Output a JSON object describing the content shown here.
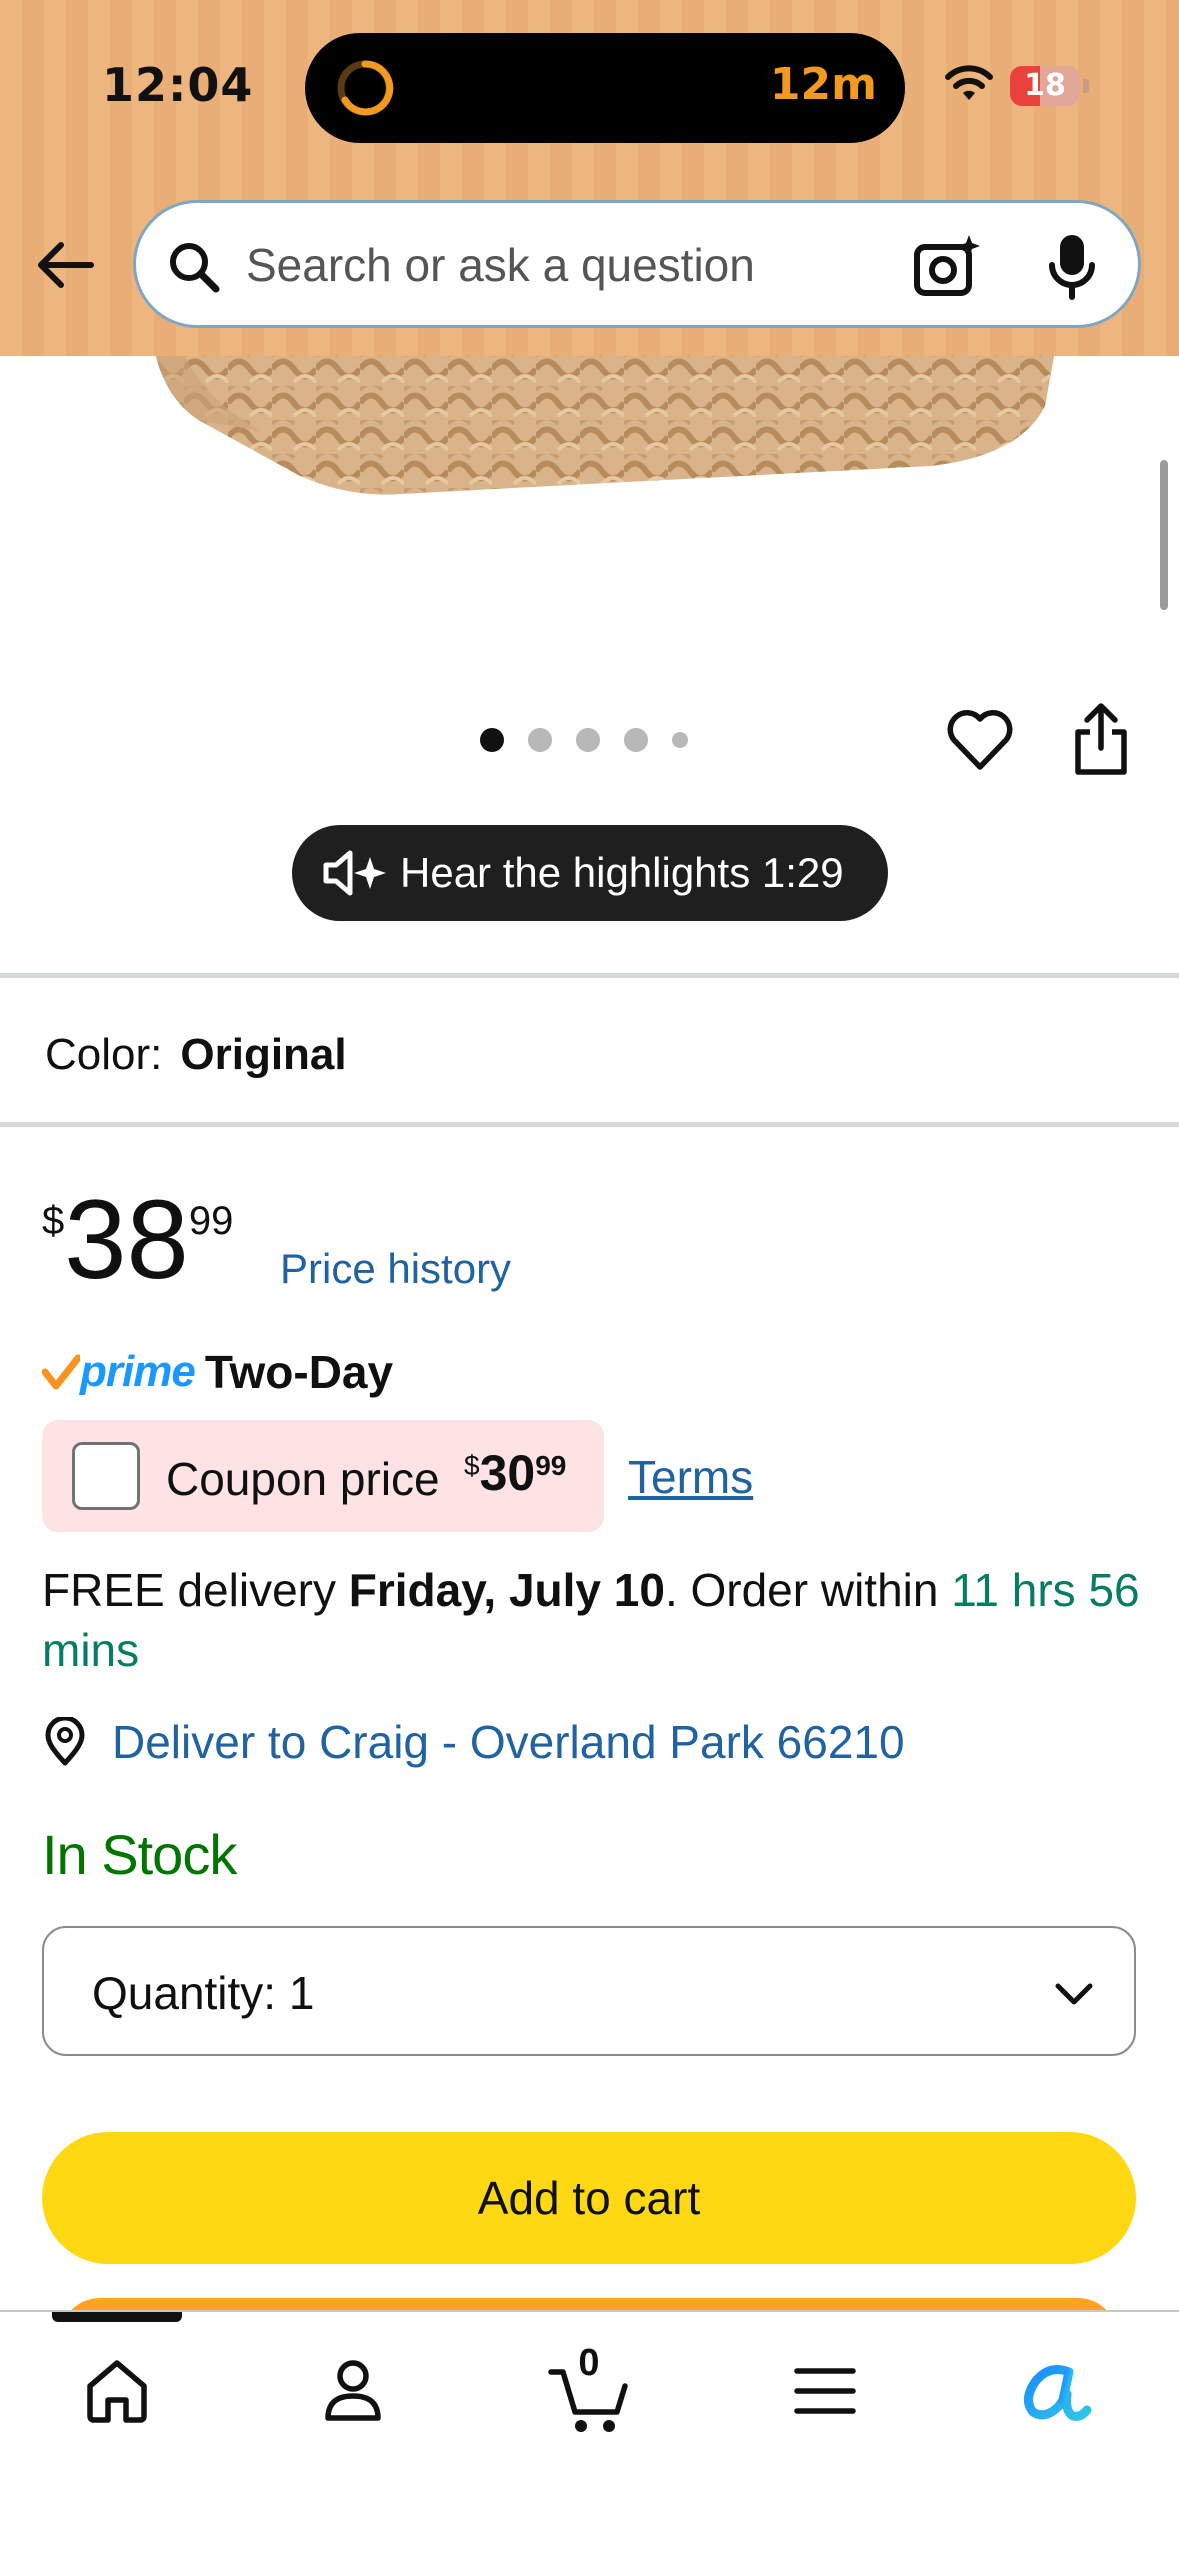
{
  "status_bar": {
    "time": "12:04",
    "activity_text": "12m",
    "battery": "18"
  },
  "search": {
    "placeholder": "Search or ask a question"
  },
  "gallery": {
    "dot_count": 5,
    "active_index": 0
  },
  "audio": {
    "label": "Hear the highlights 1:29"
  },
  "color": {
    "label": "Color:",
    "value": "Original"
  },
  "price": {
    "symbol": "$",
    "whole": "38",
    "fraction": "99",
    "history_link": "Price history"
  },
  "prime": {
    "word": "prime",
    "shipping": "Two-Day"
  },
  "coupon": {
    "label": "Coupon price",
    "symbol": "$",
    "whole": "30",
    "fraction": "99",
    "terms_link": "Terms"
  },
  "delivery": {
    "prefix": "FREE delivery ",
    "date": "Friday, July 10",
    "middle": ". Order within ",
    "countdown": "11 hrs 56 mins"
  },
  "deliver_to": {
    "text": "Deliver to Craig - Overland Park 66210"
  },
  "stock": {
    "status": "In Stock"
  },
  "quantity": {
    "label": "Quantity:",
    "value": "1"
  },
  "actions": {
    "add_to_cart": "Add to cart"
  },
  "bottom_nav": {
    "cart_count": "0",
    "items": [
      "home-icon",
      "account-icon",
      "cart-icon",
      "menu-icon",
      "rufus-icon"
    ]
  },
  "colors": {
    "header_bg": "#eeb67f",
    "add_to_cart": "#ffd814",
    "link": "#2162a1",
    "in_stock": "#007600",
    "coupon_bg": "#fde3e3"
  }
}
